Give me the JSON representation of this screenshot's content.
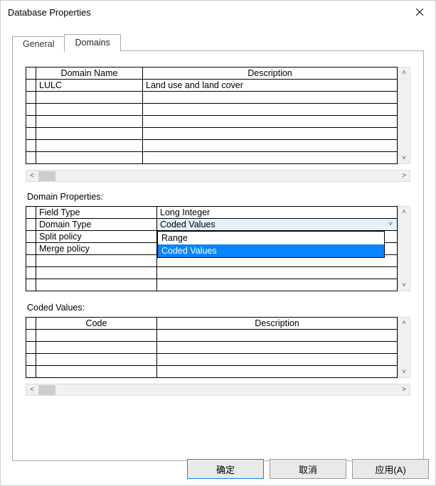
{
  "window": {
    "title": "Database Properties"
  },
  "tabs": {
    "general": "General",
    "domains": "Domains",
    "active": "domains"
  },
  "domains_grid": {
    "header_name": "Domain Name",
    "header_desc": "Description",
    "rows": [
      {
        "name": "LULC",
        "desc": "Land use and land cover"
      },
      {
        "name": "",
        "desc": ""
      },
      {
        "name": "",
        "desc": ""
      },
      {
        "name": "",
        "desc": ""
      },
      {
        "name": "",
        "desc": ""
      },
      {
        "name": "",
        "desc": ""
      },
      {
        "name": "",
        "desc": ""
      }
    ]
  },
  "domain_properties": {
    "label": "Domain Properties:",
    "rows": {
      "field_type_label": "Field Type",
      "field_type_value": "Long Integer",
      "domain_type_label": "Domain Type",
      "domain_type_value": "Coded Values",
      "split_policy_label": "Split policy",
      "split_policy_value": "",
      "merge_policy_label": "Merge policy",
      "merge_policy_value": ""
    },
    "dropdown_options": [
      {
        "label": "Range",
        "selected": false
      },
      {
        "label": "Coded Values",
        "selected": true
      }
    ]
  },
  "coded_values": {
    "label": "Coded Values:",
    "header_code": "Code",
    "header_desc": "Description",
    "rows": [
      {
        "code": "",
        "desc": ""
      },
      {
        "code": "",
        "desc": ""
      },
      {
        "code": "",
        "desc": ""
      },
      {
        "code": "",
        "desc": ""
      }
    ]
  },
  "buttons": {
    "ok": "确定",
    "cancel": "取消",
    "apply": "应用(A)"
  }
}
